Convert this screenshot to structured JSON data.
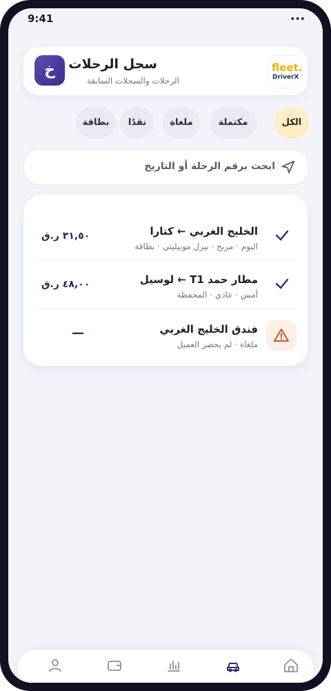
{
  "status": {
    "time": "9:41",
    "indicator": "•••"
  },
  "header": {
    "title": "سجل الرحلات",
    "subtitle": "الرحلات والسجلات السابقة",
    "avatar_letter": "خ",
    "logo_line1": "fleet.",
    "logo_line2": "DriverX"
  },
  "filters": [
    {
      "label": "الكل",
      "active": true
    },
    {
      "label": "مكتملة"
    },
    {
      "label": "ملغاة"
    },
    {
      "label": "نقدًا"
    },
    {
      "label": "بطاقة"
    }
  ],
  "search": {
    "placeholder": "ابحث برقم الرحلة أو التاريخ"
  },
  "trips": [
    {
      "route": "الخليج الغربي ← كتارا",
      "meta": "اليوم · مربح · بيرل موبيليتي · بطاقة",
      "fare": "٣١,٥٠ ر.ق",
      "status": "completed"
    },
    {
      "route": "مطار حمد T1 ← لوسيل",
      "meta": "أمس · عادي · المحفظة",
      "fare": "٤٨,٠٠ ر.ق",
      "status": "completed"
    },
    {
      "route": "فندق الخليج الغربي",
      "meta": "ملغاة · لم يحضر العميل",
      "fare": "—",
      "status": "cancelled"
    }
  ],
  "colors": {
    "accent": "#2f2a6e",
    "active_chip": "#fdecc4",
    "warning": "#c25a2a"
  },
  "tabs": [
    {
      "icon": "home-icon"
    },
    {
      "icon": "car-icon",
      "active": true
    },
    {
      "icon": "chart-icon"
    },
    {
      "icon": "wallet-icon"
    },
    {
      "icon": "profile-icon"
    }
  ]
}
